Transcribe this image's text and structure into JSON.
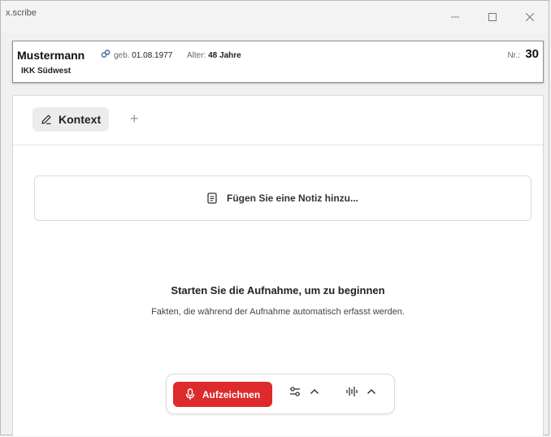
{
  "window": {
    "title": "x.scribe"
  },
  "patient": {
    "name": "Mustermann",
    "dob_label": "geb.",
    "dob": "01.08.1977",
    "age_label": "Alter:",
    "age": "48 Jahre",
    "insurance": "IKK Südwest",
    "nr_label": "Nr.:",
    "nr": "30"
  },
  "tabs": {
    "kontext_label": "Kontext",
    "add_label": "+"
  },
  "note": {
    "placeholder": "Fügen Sie eine Notiz hinzu..."
  },
  "empty_state": {
    "title": "Starten Sie die Aufnahme, um zu beginnen",
    "subtitle": "Fakten, die während der Aufnahme automatisch erfasst werden."
  },
  "toolbar": {
    "record_label": "Aufzeichnen"
  },
  "icons": {
    "link": "link-icon",
    "pencil": "pencil-icon",
    "note": "note-icon",
    "mic": "microphone-icon",
    "settings": "sliders-icon",
    "audio": "waveform-icon",
    "chevron": "chevron-up-icon"
  },
  "colors": {
    "accent_red": "#dd2b2b",
    "link_icon": "#4a6fb5"
  }
}
